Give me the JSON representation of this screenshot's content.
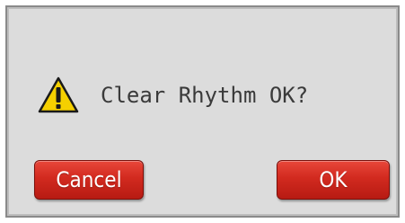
{
  "dialog": {
    "message": "Clear Rhythm OK?",
    "icon": "warning-triangle-icon",
    "cancel_label": "Cancel",
    "ok_label": "OK"
  },
  "colors": {
    "dialog_background": "#dcdcdc",
    "button_red": "#d22a1f",
    "warning_yellow": "#f5d000",
    "text": "#3a3a3a"
  }
}
